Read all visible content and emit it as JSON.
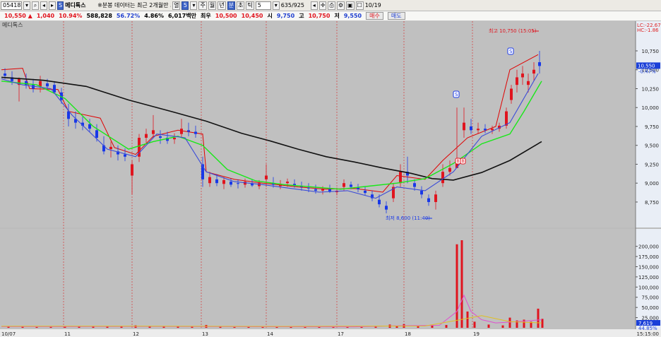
{
  "toolbar": {
    "code": "05418",
    "name_chip": "S",
    "name": "메디톡스",
    "notice": "※분봉 데이터는 최근 2개월만 조",
    "min_label": "열",
    "min_value": "5",
    "period_buttons": [
      "주",
      "월",
      "년",
      "분",
      "초",
      "틱"
    ],
    "tick_value": "5",
    "count": "635/925",
    "date": "10/19"
  },
  "quote": {
    "price": "10,550 ▲",
    "change": "1,040",
    "change_pct": "10.94%",
    "volume": "588,828",
    "vol_ratio": "56.72%",
    "turnover_pct": "4.86%",
    "amount": "6,017백만",
    "prev_label": "최우",
    "prev": "10,500",
    "open_label": "시",
    "open": "10,450",
    "low_label": "",
    "low": "9,750",
    "high_label": "고",
    "high": "10,750",
    "close_label": "저",
    "close": "9,550",
    "buy_label": "매수",
    "sell_label": "매도"
  },
  "chart_data": {
    "type": "candlestick",
    "title": "메디톡스",
    "price_axis": {
      "ticks": [
        "10,750",
        "10,500",
        "10,250",
        "10,000",
        "9,750",
        "9,500",
        "9,250",
        "9,000",
        "8,750"
      ],
      "current_label": "10,550",
      "current_sub": "-0.47%",
      "lc_label": "LC:-22.67",
      "hc_label": "HC:-1.86"
    },
    "volume_axis": {
      "ticks": [
        "200,000",
        "175,000",
        "150,000",
        "125,000",
        "100,000",
        "75,000",
        "50,000",
        "25,000"
      ],
      "badge_value": "7,619",
      "badge_pct": "44.85%"
    },
    "date_labels": [
      "10/07",
      "11",
      "12",
      "13",
      "14",
      "17",
      "18",
      "19"
    ],
    "time_right": "15:15:00",
    "annotations": {
      "high": "최고 10,750 (15:05)",
      "low": "최저 8,600 (11:40)",
      "marker_s": "S",
      "marker_b": "B"
    },
    "ma_long": [
      [
        0,
        10400
      ],
      [
        60,
        10360
      ],
      [
        120,
        10280
      ],
      [
        180,
        10100
      ],
      [
        240,
        9950
      ],
      [
        290,
        9820
      ],
      [
        340,
        9660
      ],
      [
        380,
        9560
      ],
      [
        420,
        9450
      ],
      [
        460,
        9350
      ],
      [
        500,
        9280
      ],
      [
        540,
        9200
      ],
      [
        580,
        9130
      ],
      [
        610,
        9060
      ],
      [
        640,
        9040
      ],
      [
        680,
        9140
      ],
      [
        720,
        9300
      ],
      [
        765,
        9550
      ]
    ],
    "ma_mid": [
      [
        0,
        10350
      ],
      [
        50,
        10300
      ],
      [
        90,
        10120
      ],
      [
        130,
        9750
      ],
      [
        180,
        9450
      ],
      [
        215,
        9550
      ],
      [
        250,
        9620
      ],
      [
        285,
        9500
      ],
      [
        320,
        9180
      ],
      [
        360,
        9030
      ],
      [
        400,
        8980
      ],
      [
        440,
        8950
      ],
      [
        480,
        8920
      ],
      [
        520,
        8960
      ],
      [
        560,
        9000
      ],
      [
        600,
        9060
      ],
      [
        640,
        9260
      ],
      [
        680,
        9520
      ],
      [
        720,
        9650
      ],
      [
        740,
        9950
      ],
      [
        765,
        10350
      ]
    ],
    "ma_short": [
      [
        0,
        10380
      ],
      [
        30,
        10300
      ],
      [
        70,
        10250
      ],
      [
        100,
        9900
      ],
      [
        150,
        9450
      ],
      [
        190,
        9350
      ],
      [
        220,
        9650
      ],
      [
        260,
        9600
      ],
      [
        290,
        9150
      ],
      [
        330,
        9020
      ],
      [
        370,
        8980
      ],
      [
        410,
        8930
      ],
      [
        450,
        8880
      ],
      [
        490,
        8900
      ],
      [
        530,
        8800
      ],
      [
        560,
        8950
      ],
      [
        600,
        8900
      ],
      [
        640,
        9150
      ],
      [
        680,
        9620
      ],
      [
        720,
        9800
      ],
      [
        760,
        10450
      ]
    ],
    "envelope": [
      [
        0,
        10500
      ],
      [
        30,
        10520
      ],
      [
        40,
        10250
      ],
      [
        80,
        10240
      ],
      [
        95,
        9950
      ],
      [
        140,
        9860
      ],
      [
        160,
        9470
      ],
      [
        190,
        9380
      ],
      [
        215,
        9620
      ],
      [
        250,
        9700
      ],
      [
        285,
        9650
      ],
      [
        290,
        9150
      ],
      [
        330,
        9050
      ],
      [
        370,
        9000
      ],
      [
        420,
        8950
      ],
      [
        460,
        8920
      ],
      [
        500,
        8930
      ],
      [
        540,
        8880
      ],
      [
        560,
        9100
      ],
      [
        600,
        9050
      ],
      [
        625,
        9300
      ],
      [
        660,
        9600
      ],
      [
        700,
        9750
      ],
      [
        720,
        10500
      ],
      [
        760,
        10700
      ]
    ],
    "candles": [
      [
        5,
        10450,
        10520,
        10380,
        10420
      ],
      [
        15,
        10400,
        10480,
        10300,
        10350
      ],
      [
        25,
        10300,
        10400,
        10080,
        10380
      ],
      [
        35,
        10350,
        10450,
        10250,
        10300
      ],
      [
        45,
        10300,
        10380,
        10200,
        10250
      ],
      [
        55,
        10280,
        10420,
        10200,
        10350
      ],
      [
        65,
        10320,
        10380,
        10250,
        10280
      ],
      [
        75,
        10300,
        10350,
        10180,
        10200
      ],
      [
        85,
        10200,
        10260,
        10050,
        10100
      ],
      [
        95,
        9950,
        10050,
        9750,
        9850
      ],
      [
        105,
        9850,
        9950,
        9720,
        9800
      ],
      [
        115,
        9800,
        9880,
        9700,
        9760
      ],
      [
        125,
        9780,
        9850,
        9680,
        9720
      ],
      [
        135,
        9700,
        9780,
        9550,
        9600
      ],
      [
        145,
        9500,
        9620,
        9380,
        9420
      ],
      [
        155,
        9450,
        9550,
        9340,
        9480
      ],
      [
        165,
        9420,
        9500,
        9300,
        9380
      ],
      [
        175,
        9380,
        9460,
        9290,
        9350
      ],
      [
        185,
        9100,
        9300,
        8850,
        9250
      ],
      [
        195,
        9350,
        9650,
        9280,
        9600
      ],
      [
        205,
        9600,
        9720,
        9520,
        9650
      ],
      [
        215,
        9650,
        9900,
        9600,
        9700
      ],
      [
        225,
        9620,
        9700,
        9520,
        9600
      ],
      [
        235,
        9600,
        9680,
        9520,
        9560
      ],
      [
        245,
        9580,
        9660,
        9520,
        9600
      ],
      [
        255,
        9650,
        9850,
        9600,
        9720
      ],
      [
        265,
        9700,
        9800,
        9620,
        9680
      ],
      [
        275,
        9680,
        9760,
        9600,
        9650
      ],
      [
        285,
        9250,
        9350,
        8950,
        9050
      ],
      [
        295,
        9000,
        9150,
        8950,
        9080
      ],
      [
        305,
        9050,
        9120,
        8960,
        9000
      ],
      [
        315,
        8990,
        9080,
        8920,
        9040
      ],
      [
        325,
        9020,
        9060,
        8950,
        8980
      ],
      [
        335,
        9000,
        9050,
        8930,
        8990
      ],
      [
        345,
        8980,
        9060,
        8940,
        9020
      ],
      [
        355,
        9000,
        9050,
        8950,
        8970
      ],
      [
        365,
        8960,
        9040,
        8920,
        9000
      ],
      [
        375,
        9050,
        9250,
        8950,
        9100
      ],
      [
        385,
        9000,
        9080,
        8940,
        8980
      ],
      [
        395,
        8960,
        9040,
        8920,
        8990
      ],
      [
        405,
        9000,
        9060,
        8950,
        9020
      ],
      [
        415,
        8990,
        9050,
        8940,
        8970
      ],
      [
        425,
        8960,
        9020,
        8900,
        8950
      ],
      [
        435,
        8940,
        9000,
        8880,
        8930
      ],
      [
        445,
        8920,
        8980,
        8860,
        8900
      ],
      [
        455,
        8900,
        8960,
        8850,
        8920
      ],
      [
        465,
        8920,
        8980,
        8870,
        8890
      ],
      [
        475,
        8880,
        8940,
        8840,
        8900
      ],
      [
        485,
        8950,
        9050,
        8900,
        9000
      ],
      [
        495,
        8980,
        9020,
        8920,
        8950
      ],
      [
        505,
        8940,
        8990,
        8880,
        8920
      ],
      [
        515,
        8900,
        8960,
        8840,
        8870
      ],
      [
        525,
        8850,
        8900,
        8760,
        8800
      ],
      [
        535,
        8780,
        8850,
        8680,
        8720
      ],
      [
        545,
        8700,
        8760,
        8600,
        8650
      ],
      [
        555,
        8800,
        9000,
        8750,
        8950
      ],
      [
        565,
        9000,
        9250,
        8950,
        9150
      ],
      [
        575,
        9150,
        9350,
        9000,
        9100
      ],
      [
        585,
        9000,
        9050,
        8900,
        8950
      ],
      [
        595,
        8900,
        8960,
        8800,
        8850
      ],
      [
        605,
        8800,
        8850,
        8700,
        8750
      ],
      [
        615,
        8750,
        8900,
        8650,
        8850
      ],
      [
        625,
        9000,
        9250,
        8950,
        9150
      ],
      [
        635,
        9150,
        9300,
        9100,
        9200
      ],
      [
        645,
        9200,
        10000,
        9200,
        9300
      ],
      [
        655,
        9700,
        10000,
        9600,
        9800
      ],
      [
        665,
        9750,
        9850,
        9650,
        9700
      ],
      [
        675,
        9700,
        9800,
        9650,
        9720
      ],
      [
        685,
        9720,
        9780,
        9660,
        9700
      ],
      [
        695,
        9700,
        9760,
        9650,
        9720
      ],
      [
        705,
        9720,
        9800,
        9680,
        9760
      ],
      [
        715,
        9760,
        10000,
        9720,
        9950
      ],
      [
        722,
        10100,
        10300,
        10050,
        10250
      ],
      [
        730,
        10300,
        10500,
        10200,
        10400
      ],
      [
        738,
        10400,
        10550,
        10300,
        10450
      ],
      [
        746,
        10300,
        10450,
        10200,
        10350
      ],
      [
        754,
        10450,
        10600,
        10350,
        10500
      ],
      [
        762,
        10600,
        10750,
        10450,
        10550
      ]
    ],
    "volumes": [
      [
        10,
        3000
      ],
      [
        30,
        2500
      ],
      [
        50,
        2000
      ],
      [
        70,
        2200
      ],
      [
        90,
        4000
      ],
      [
        110,
        3500
      ],
      [
        130,
        3000
      ],
      [
        150,
        2500
      ],
      [
        170,
        2800
      ],
      [
        190,
        6000
      ],
      [
        210,
        3000
      ],
      [
        230,
        2500
      ],
      [
        250,
        3000
      ],
      [
        270,
        2500
      ],
      [
        290,
        7000
      ],
      [
        310,
        2500
      ],
      [
        330,
        2000
      ],
      [
        350,
        2200
      ],
      [
        370,
        2000
      ],
      [
        390,
        2400
      ],
      [
        410,
        2000
      ],
      [
        430,
        2200
      ],
      [
        450,
        1800
      ],
      [
        470,
        2000
      ],
      [
        490,
        2200
      ],
      [
        510,
        2000
      ],
      [
        530,
        2500
      ],
      [
        550,
        8000
      ],
      [
        560,
        5000
      ],
      [
        570,
        9000
      ],
      [
        590,
        4000
      ],
      [
        610,
        6000
      ],
      [
        630,
        7000
      ],
      [
        645,
        205000
      ],
      [
        652,
        215000
      ],
      [
        660,
        40000
      ],
      [
        670,
        15000
      ],
      [
        690,
        8000
      ],
      [
        710,
        6000
      ],
      [
        720,
        25000
      ],
      [
        730,
        18000
      ],
      [
        740,
        20000
      ],
      [
        750,
        15000
      ],
      [
        760,
        47000
      ],
      [
        766,
        22000
      ]
    ],
    "volume_ma": [
      [
        0,
        3000
      ],
      [
        100,
        3200
      ],
      [
        200,
        3500
      ],
      [
        300,
        3000
      ],
      [
        400,
        2600
      ],
      [
        500,
        2500
      ],
      [
        560,
        5000
      ],
      [
        620,
        6000
      ],
      [
        645,
        40000
      ],
      [
        655,
        80000
      ],
      [
        665,
        40000
      ],
      [
        680,
        20000
      ],
      [
        700,
        12000
      ],
      [
        730,
        15000
      ],
      [
        765,
        20000
      ]
    ],
    "volume_ma2": [
      [
        0,
        4000
      ],
      [
        200,
        4200
      ],
      [
        400,
        3500
      ],
      [
        600,
        4500
      ],
      [
        650,
        20000
      ],
      [
        680,
        30000
      ],
      [
        720,
        15000
      ],
      [
        765,
        12000
      ]
    ]
  }
}
